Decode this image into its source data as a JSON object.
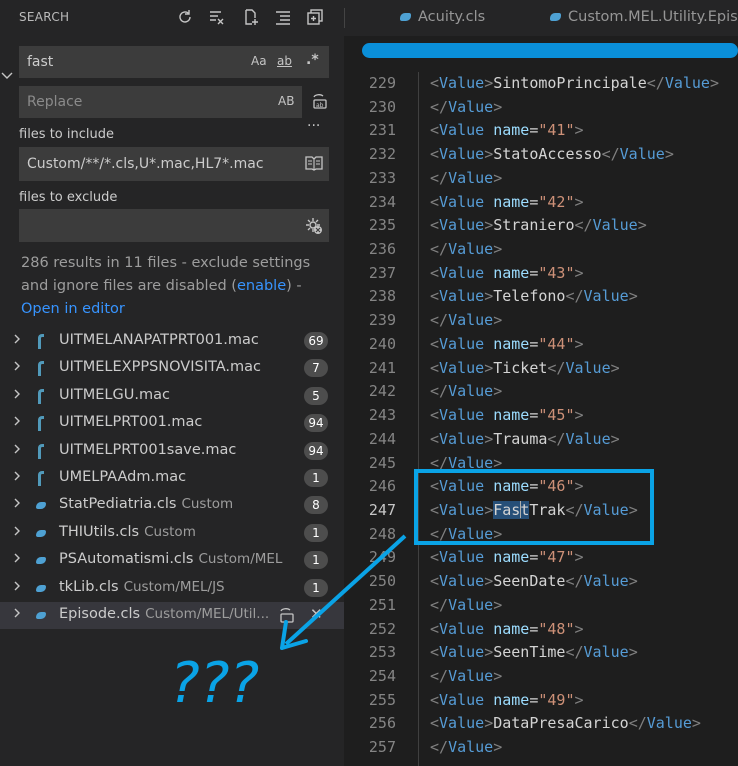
{
  "sidebar": {
    "title": "SEARCH",
    "header_icons": [
      "refresh-icon",
      "clear-results-icon",
      "new-search-editor-icon",
      "collapse-all-icon",
      "view-as-tree-icon"
    ],
    "search": {
      "value": "fast",
      "opt_case": "Aa",
      "opt_word": "ab",
      "opt_regex": ".*"
    },
    "replace": {
      "placeholder": "Replace",
      "opt_preserve_case": "AB"
    },
    "more": "···",
    "include": {
      "label": "files to include",
      "value": "Custom/**/*.cls,U*.mac,HL7*.mac"
    },
    "exclude": {
      "label": "files to exclude",
      "value": ""
    },
    "message": {
      "text1": "286 results in 11 files - exclude settings and ignore files are disabled (",
      "link1": "enable",
      "text2": ") -",
      "link2": "Open in editor"
    },
    "results": [
      {
        "name": "UITMELANAPATPRT001.mac",
        "path": "",
        "count": "69",
        "type": "mac"
      },
      {
        "name": "UITMELEXPPSNOVISITA.mac",
        "path": "",
        "count": "7",
        "type": "mac"
      },
      {
        "name": "UITMELGU.mac",
        "path": "",
        "count": "5",
        "type": "mac"
      },
      {
        "name": "UITMELPRT001.mac",
        "path": "",
        "count": "94",
        "type": "mac"
      },
      {
        "name": "UITMELPRT001save.mac",
        "path": "",
        "count": "94",
        "type": "mac"
      },
      {
        "name": "UMELPAAdm.mac",
        "path": "",
        "count": "1",
        "type": "mac"
      },
      {
        "name": "StatPediatria.cls",
        "path": "Custom",
        "count": "8",
        "type": "cls"
      },
      {
        "name": "THIUtils.cls",
        "path": "Custom",
        "count": "1",
        "type": "cls"
      },
      {
        "name": "PSAutomatismi.cls",
        "path": "Custom/MEL",
        "count": "1",
        "type": "cls"
      },
      {
        "name": "tkLib.cls",
        "path": "Custom/MEL/JS",
        "count": "1",
        "type": "cls"
      },
      {
        "name": "Episode.cls",
        "path": "Custom/MEL/Util...",
        "count": "",
        "type": "cls",
        "selected": true
      }
    ]
  },
  "editor": {
    "tabs": [
      "Acuity.cls",
      "Custom.MEL.Utility.Epis"
    ],
    "lines": [
      {
        "n": "229",
        "kind": "value",
        "text": "SintomoPrincipale"
      },
      {
        "n": "230",
        "kind": "close"
      },
      {
        "n": "231",
        "kind": "name",
        "text": "41"
      },
      {
        "n": "232",
        "kind": "value",
        "text": "StatoAccesso"
      },
      {
        "n": "233",
        "kind": "close"
      },
      {
        "n": "234",
        "kind": "name",
        "text": "42"
      },
      {
        "n": "235",
        "kind": "value",
        "text": "Straniero"
      },
      {
        "n": "236",
        "kind": "close"
      },
      {
        "n": "237",
        "kind": "name",
        "text": "43"
      },
      {
        "n": "238",
        "kind": "value",
        "text": "Telefono"
      },
      {
        "n": "239",
        "kind": "close"
      },
      {
        "n": "240",
        "kind": "name",
        "text": "44"
      },
      {
        "n": "241",
        "kind": "value",
        "text": "Ticket"
      },
      {
        "n": "242",
        "kind": "close"
      },
      {
        "n": "243",
        "kind": "name",
        "text": "45"
      },
      {
        "n": "244",
        "kind": "value",
        "text": "Trauma"
      },
      {
        "n": "245",
        "kind": "close"
      },
      {
        "n": "246",
        "kind": "name",
        "text": "46"
      },
      {
        "n": "247",
        "kind": "match",
        "pre": "Fas",
        "post": "Trak",
        "mid": "t"
      },
      {
        "n": "248",
        "kind": "close"
      },
      {
        "n": "249",
        "kind": "name",
        "text": "47"
      },
      {
        "n": "250",
        "kind": "value",
        "text": "SeenDate"
      },
      {
        "n": "251",
        "kind": "close"
      },
      {
        "n": "252",
        "kind": "name",
        "text": "48"
      },
      {
        "n": "253",
        "kind": "value",
        "text": "SeenTime"
      },
      {
        "n": "254",
        "kind": "close"
      },
      {
        "n": "255",
        "kind": "name",
        "text": "49"
      },
      {
        "n": "256",
        "kind": "value",
        "text": "DataPresaCarico"
      },
      {
        "n": "257",
        "kind": "close"
      }
    ],
    "current_line": "247"
  },
  "annotation": {
    "text": "???",
    "color": "#0aa3e6"
  },
  "colors": {
    "accent": "#0a8fd9",
    "link": "#3794ff",
    "annotation": "#0aa3e6"
  }
}
